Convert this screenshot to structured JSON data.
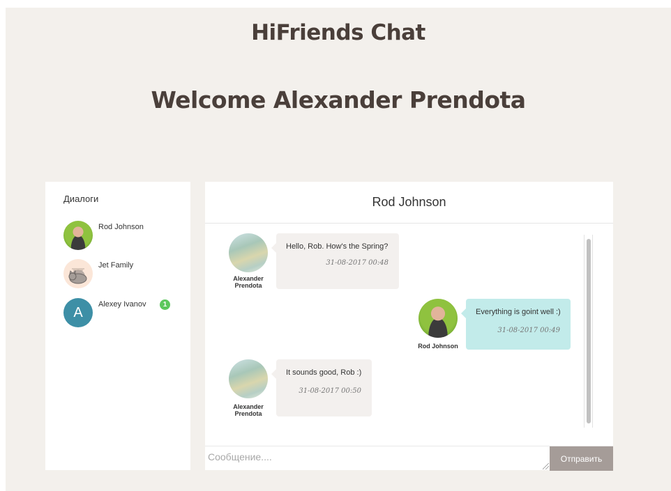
{
  "app": {
    "title": "HiFriends Chat",
    "welcome": "Welcome Alexander Prendota"
  },
  "sidebar": {
    "title": "Диалоги",
    "dialogs": [
      {
        "name": "Rod Johnson",
        "avatar": "photo-avatar"
      },
      {
        "name": "Jet Family",
        "avatar": "cat-avatar"
      },
      {
        "name": "Alexey Ivanov",
        "avatar_letter": "A",
        "unread": "1"
      }
    ]
  },
  "chat": {
    "contact": "Rod Johnson",
    "messages": [
      {
        "author": "Alexander Prendota",
        "text": "Hello, Rob. How's the Spring?",
        "time": "31-08-2017 00:48",
        "direction": "incoming"
      },
      {
        "author": "Rod Johnson",
        "text": "Everything is goint well :)",
        "time": "31-08-2017 00:49",
        "direction": "outgoing"
      },
      {
        "author": "Alexander Prendota",
        "text": "It sounds good, Rob :)",
        "time": "31-08-2017 00:50",
        "direction": "incoming"
      }
    ],
    "input_placeholder": "Сообщение....",
    "send_label": "Отправить"
  },
  "colors": {
    "page_bg": "#f3f0ec",
    "title": "#4a3f3a",
    "incoming_bubble": "#f3f0ee",
    "outgoing_bubble": "#c2ebea",
    "badge": "#5cc85c",
    "letter_avatar": "#3d8fa6",
    "send_button": "#a59c98"
  }
}
